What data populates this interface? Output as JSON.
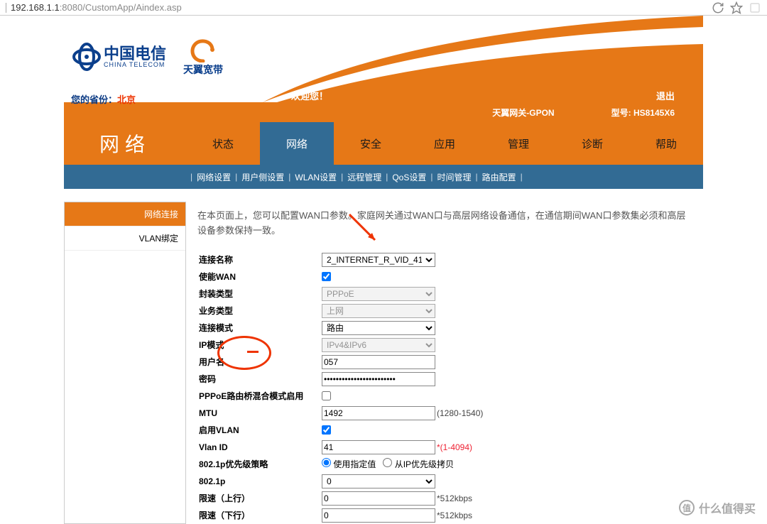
{
  "url": {
    "host": "192.168.1.1",
    "port": ":8080",
    "path": "/CustomApp/Aindex.asp"
  },
  "branding": {
    "telecom_zh": "中国电信",
    "telecom_en": "CHINA TELECOM",
    "broadband": "天翼宽带",
    "province_label": "您的省份：",
    "province_value": "北京",
    "welcome": "欢迎您！",
    "logout": "退出"
  },
  "infobar": {
    "gateway": "天翼网关-GPON",
    "model_label": "型号:",
    "model_value": "HS8145X6"
  },
  "nav": {
    "side_title": "网络",
    "items": [
      "状态",
      "网络",
      "安全",
      "应用",
      "管理",
      "诊断",
      "帮助"
    ],
    "active_index": 1
  },
  "subnav": [
    "网络设置",
    "用户侧设置",
    "WLAN设置",
    "远程管理",
    "QoS设置",
    "时间管理",
    "路由配置"
  ],
  "sidebar": {
    "items": [
      "网络连接",
      "VLAN绑定"
    ],
    "active_index": 0
  },
  "intro": "在本页面上，您可以配置WAN口参数。家庭网关通过WAN口与高层网络设备通信，在通信期间WAN口参数集必须和高层设备参数保持一致。",
  "form": {
    "conn_name_label": "连接名称",
    "conn_name_value": "2_INTERNET_R_VID_41",
    "enable_wan_label": "使能WAN",
    "enable_wan_checked": true,
    "encap_label": "封装类型",
    "encap_value": "PPPoE",
    "service_label": "业务类型",
    "service_value": "上网",
    "conn_mode_label": "连接模式",
    "conn_mode_value": "路由",
    "ip_mode_label": "IP模式",
    "ip_mode_value": "IPv4&IPv6",
    "user_label": "用户名",
    "user_value": "057",
    "pwd_label": "密码",
    "pwd_value": "••••••••••••••••••••••••",
    "hybrid_label": "PPPoE路由桥混合模式启用",
    "hybrid_checked": false,
    "mtu_label": "MTU",
    "mtu_value": "1492",
    "mtu_hint": "(1280-1540)",
    "vlan_en_label": "启用VLAN",
    "vlan_en_checked": true,
    "vlan_id_label": "Vlan ID",
    "vlan_id_value": "41",
    "vlan_id_hint": "*(1-4094)",
    "prio_label": "802.1p优先级策略",
    "prio_opt1": "使用指定值",
    "prio_opt2": "从IP优先级拷贝",
    "p8021_label": "802.1p",
    "p8021_value": "0",
    "rate_up_label": "限速（上行）",
    "rate_up_value": "0",
    "rate_up_hint": "*512kbps",
    "rate_dn_label": "限速（下行）",
    "rate_dn_value": "0",
    "rate_dn_hint": "*512kbps"
  },
  "watermark": {
    "glyph": "值",
    "text": "什么值得买"
  }
}
